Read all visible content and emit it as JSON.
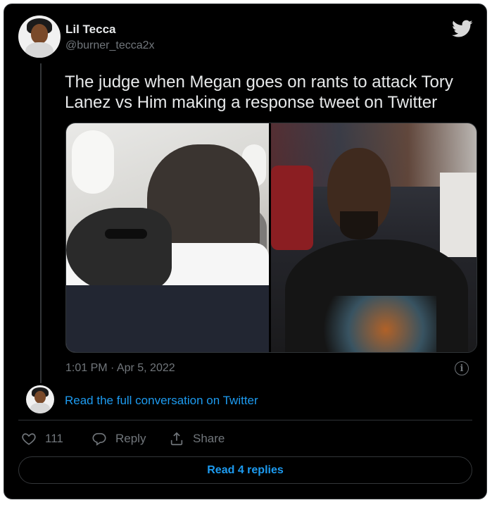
{
  "tweet": {
    "author_name": "Lil Tecca",
    "author_handle": "@burner_tecca2x",
    "text": "The judge when Megan goes on rants to attack Tory Lanez vs Him making a response tweet on Twitter",
    "timestamp": "1:01 PM · Apr 5, 2022",
    "info_icon": "i"
  },
  "conversation": {
    "link_text": "Read the full conversation on Twitter"
  },
  "actions": {
    "like_count": "111",
    "reply_label": "Reply",
    "share_label": "Share"
  },
  "footer": {
    "read_replies_label": "Read 4 replies"
  },
  "icons": {
    "brand": "twitter-bird-icon",
    "like": "heart-icon",
    "reply": "speech-bubble-icon",
    "share": "share-upload-icon",
    "info": "info-icon"
  },
  "colors": {
    "background": "#000000",
    "text_primary": "#e7e9ea",
    "text_secondary": "#71767b",
    "accent": "#1d9bf0",
    "border": "#2f3336"
  }
}
